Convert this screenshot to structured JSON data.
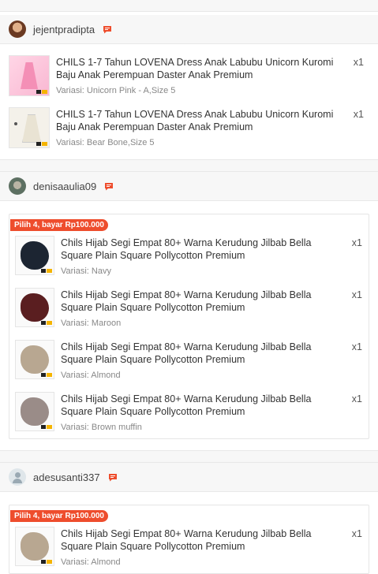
{
  "colors": {
    "accent": "#ee4d2d",
    "navy": "#1c2532",
    "maroon": "#5a1e20",
    "almond": "#b8a791",
    "brown_muffin": "#9a8c88"
  },
  "groups": [
    {
      "username": "jejentpradipta",
      "items": [
        {
          "title": "CHILS 1-7 Tahun LOVENA Dress Anak Labubu Unicorn Kuromi Baju Anak Perempuan Daster Anak Premium",
          "variant": "Variasi: Unicorn Pink - A,Size 5",
          "qty": "x1"
        },
        {
          "title": "CHILS 1-7 Tahun LOVENA Dress Anak Labubu Unicorn Kuromi Baju Anak Perempuan Daster Anak Premium",
          "variant": "Variasi: Bear Bone,Size 5",
          "qty": "x1"
        }
      ]
    },
    {
      "username": "denisaaulia09",
      "promo": "Pilih 4, bayar Rp100.000",
      "items": [
        {
          "title": "Chils Hijab Segi Empat 80+ Warna Kerudung Jilbab Bella Square Plain Square Pollycotton Premium",
          "variant": "Variasi: Navy",
          "qty": "x1"
        },
        {
          "title": "Chils Hijab Segi Empat 80+ Warna Kerudung Jilbab Bella Square Plain Square Pollycotton Premium",
          "variant": "Variasi: Maroon",
          "qty": "x1"
        },
        {
          "title": "Chils Hijab Segi Empat 80+ Warna Kerudung Jilbab Bella Square Plain Square Pollycotton Premium",
          "variant": "Variasi: Almond",
          "qty": "x1"
        },
        {
          "title": "Chils Hijab Segi Empat 80+ Warna Kerudung Jilbab Bella Square Plain Square Pollycotton Premium",
          "variant": "Variasi: Brown muffin",
          "qty": "x1"
        }
      ]
    },
    {
      "username": "adesusanti337",
      "promo": "Pilih 4, bayar Rp100.000",
      "items": [
        {
          "title": "Chils Hijab Segi Empat 80+ Warna Kerudung Jilbab Bella Square Plain Square Pollycotton Premium",
          "variant": "Variasi: Almond",
          "qty": "x1"
        }
      ]
    }
  ]
}
